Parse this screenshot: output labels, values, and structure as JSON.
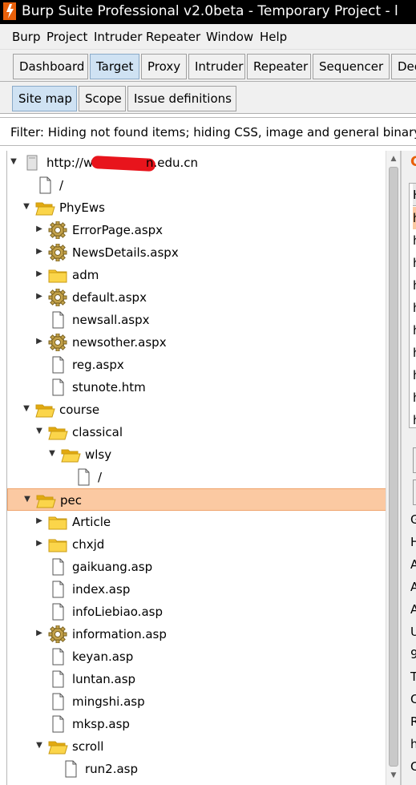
{
  "window": {
    "title": "Burp Suite Professional v2.0beta - Temporary Project - l"
  },
  "menu": [
    "Burp",
    "Project",
    "Intruder",
    "Repeater",
    "Window",
    "Help"
  ],
  "main_tabs": [
    "Dashboard",
    "Target",
    "Proxy",
    "Intruder",
    "Repeater",
    "Sequencer",
    "Dec"
  ],
  "sub_tabs": [
    "Site map",
    "Scope",
    "Issue definitions"
  ],
  "filter_text": "Filter: Hiding not found items;  hiding CSS, image and general binary",
  "tree": [
    {
      "label": "http://w",
      "label_tail": "n.edu.cn",
      "icon": "host-icon",
      "arrow": "expanded",
      "indent": 0
    },
    {
      "label": "/",
      "icon": "file-icon",
      "arrow": "none",
      "indent": 1
    },
    {
      "label": "PhyEws",
      "icon": "folder-open-icon",
      "arrow": "expanded",
      "indent": 1
    },
    {
      "label": "ErrorPage.aspx",
      "icon": "gear-icon",
      "arrow": "collapsed",
      "indent": 2
    },
    {
      "label": "NewsDetails.aspx",
      "icon": "gear-icon",
      "arrow": "collapsed",
      "indent": 2
    },
    {
      "label": "adm",
      "icon": "folder-icon",
      "arrow": "collapsed",
      "indent": 2
    },
    {
      "label": "default.aspx",
      "icon": "gear-icon",
      "arrow": "collapsed",
      "indent": 2
    },
    {
      "label": "newsall.aspx",
      "icon": "file-icon",
      "arrow": "none",
      "indent": 2
    },
    {
      "label": "newsother.aspx",
      "icon": "gear-icon",
      "arrow": "collapsed",
      "indent": 2
    },
    {
      "label": "reg.aspx",
      "icon": "file-icon",
      "arrow": "none",
      "indent": 2
    },
    {
      "label": "stunote.htm",
      "icon": "file-icon",
      "arrow": "none",
      "indent": 2
    },
    {
      "label": "course",
      "icon": "folder-open-icon",
      "arrow": "expanded",
      "indent": 1
    },
    {
      "label": "classical",
      "icon": "folder-open-icon",
      "arrow": "expanded",
      "indent": 2
    },
    {
      "label": "wlsy",
      "icon": "folder-open-icon",
      "arrow": "expanded",
      "indent": 3
    },
    {
      "label": "/",
      "icon": "file-icon",
      "arrow": "none",
      "indent": 4
    },
    {
      "label": "pec",
      "icon": "folder-open-icon",
      "arrow": "expanded",
      "indent": 1,
      "selected": true
    },
    {
      "label": "Article",
      "icon": "folder-icon",
      "arrow": "collapsed",
      "indent": 2
    },
    {
      "label": "chxjd",
      "icon": "folder-icon",
      "arrow": "collapsed",
      "indent": 2
    },
    {
      "label": "gaikuang.asp",
      "icon": "file-icon",
      "arrow": "none",
      "indent": 2
    },
    {
      "label": "index.asp",
      "icon": "file-icon",
      "arrow": "none",
      "indent": 2
    },
    {
      "label": "infoLiebiao.asp",
      "icon": "file-icon",
      "arrow": "none",
      "indent": 2
    },
    {
      "label": "information.asp",
      "icon": "gear-icon",
      "arrow": "collapsed",
      "indent": 2
    },
    {
      "label": "keyan.asp",
      "icon": "file-icon",
      "arrow": "none",
      "indent": 2
    },
    {
      "label": "luntan.asp",
      "icon": "file-icon",
      "arrow": "none",
      "indent": 2
    },
    {
      "label": "mingshi.asp",
      "icon": "file-icon",
      "arrow": "none",
      "indent": 2
    },
    {
      "label": "mksp.asp",
      "icon": "file-icon",
      "arrow": "none",
      "indent": 2
    },
    {
      "label": "scroll",
      "icon": "folder-open-icon",
      "arrow": "expanded",
      "indent": 2
    },
    {
      "label": "run2.asp",
      "icon": "file-icon",
      "arrow": "none",
      "indent": 3
    }
  ],
  "right_pane": {
    "title_glyph": "C",
    "table_header": "H",
    "table_rows": [
      "h",
      "h",
      "h",
      "h",
      "h",
      "h",
      "h",
      "h",
      "h",
      "h"
    ],
    "request_lines": [
      "G",
      "H",
      "A",
      "A",
      "A",
      "U",
      "9",
      "T",
      "C",
      "R",
      "h",
      "C"
    ]
  },
  "colors": {
    "selection": "#fbc9a2",
    "active_tab": "#cfe2f3",
    "accent": "#e8600a"
  }
}
